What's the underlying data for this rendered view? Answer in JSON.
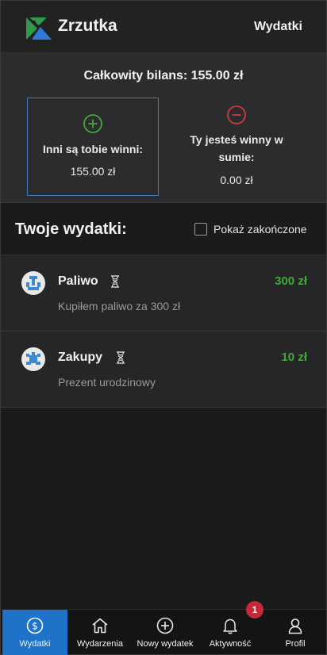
{
  "header": {
    "app_title": "Zrzutka",
    "link": "Wydatki"
  },
  "balance": {
    "title": "Całkowity bilans: 155.00 zł",
    "owed": {
      "label": "Inni są tobie winni:",
      "amount": "155.00 zł"
    },
    "owe": {
      "label": "Ty jesteś winny w sumie:",
      "amount": "0.00 zł"
    },
    "colors": {
      "positive": "#41a83a",
      "negative": "#d23a3a",
      "accent": "#3e7bb8"
    }
  },
  "expenses_section": {
    "title": "Twoje wydatki:",
    "show_finished_label": "Pokaż zakończone",
    "show_finished_checked": false
  },
  "expenses": [
    {
      "name": "Paliwo",
      "amount": "300 zł",
      "description": "Kupiłem paliwo za 300 zł",
      "status_icon": "hourglass-icon"
    },
    {
      "name": "Zakupy",
      "amount": "10 zł",
      "description": "Prezent urodzinowy",
      "status_icon": "hourglass-icon"
    }
  ],
  "nav": {
    "items": [
      {
        "label": "Wydatki",
        "icon": "dollar-circle-icon",
        "active": true
      },
      {
        "label": "Wydarzenia",
        "icon": "home-icon",
        "active": false
      },
      {
        "label": "Nowy wydatek",
        "icon": "plus-circle-icon",
        "active": false
      },
      {
        "label": "Aktywność",
        "icon": "bell-icon",
        "active": false
      },
      {
        "label": "Profil",
        "icon": "user-icon",
        "active": false
      }
    ],
    "notification_count": "1"
  }
}
